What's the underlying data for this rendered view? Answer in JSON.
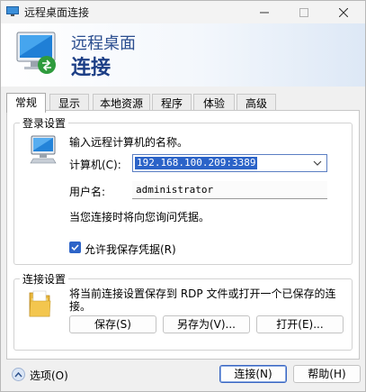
{
  "window": {
    "title": "远程桌面连接"
  },
  "banner": {
    "line1": "远程桌面",
    "line2": "连接"
  },
  "tabs": [
    {
      "label": "常规"
    },
    {
      "label": "显示"
    },
    {
      "label": "本地资源"
    },
    {
      "label": "程序"
    },
    {
      "label": "体验"
    },
    {
      "label": "高级"
    }
  ],
  "login": {
    "group_label": "登录设置",
    "prompt": "输入远程计算机的名称。",
    "computer_label": "计算机(C):",
    "computer_value": "192.168.100.209:3389",
    "username_label": "用户名:",
    "username_value": "administrator",
    "note": "当您连接时将向您询问凭据。",
    "save_credentials_label": "允许我保存凭据(R)",
    "save_credentials_checked": true
  },
  "connection": {
    "group_label": "连接设置",
    "description": "将当前连接设置保存到 RDP 文件或打开一个已保存的连接。",
    "save_label": "保存(S)",
    "save_as_label": "另存为(V)...",
    "open_label": "打开(E)..."
  },
  "footer": {
    "options_label": "选项(O)",
    "connect_label": "连接(N)",
    "help_label": "帮助(H)"
  },
  "icons": [
    "app-icon",
    "minimize-icon",
    "maximize-icon",
    "close-icon",
    "rdp-monitor-icon",
    "computer-icon",
    "dropdown-arrow-icon",
    "checkmark-icon",
    "folder-icon",
    "collapse-up-icon"
  ],
  "colors": {
    "accent": "#2b63c8",
    "banner_text": "#1d3f86"
  }
}
